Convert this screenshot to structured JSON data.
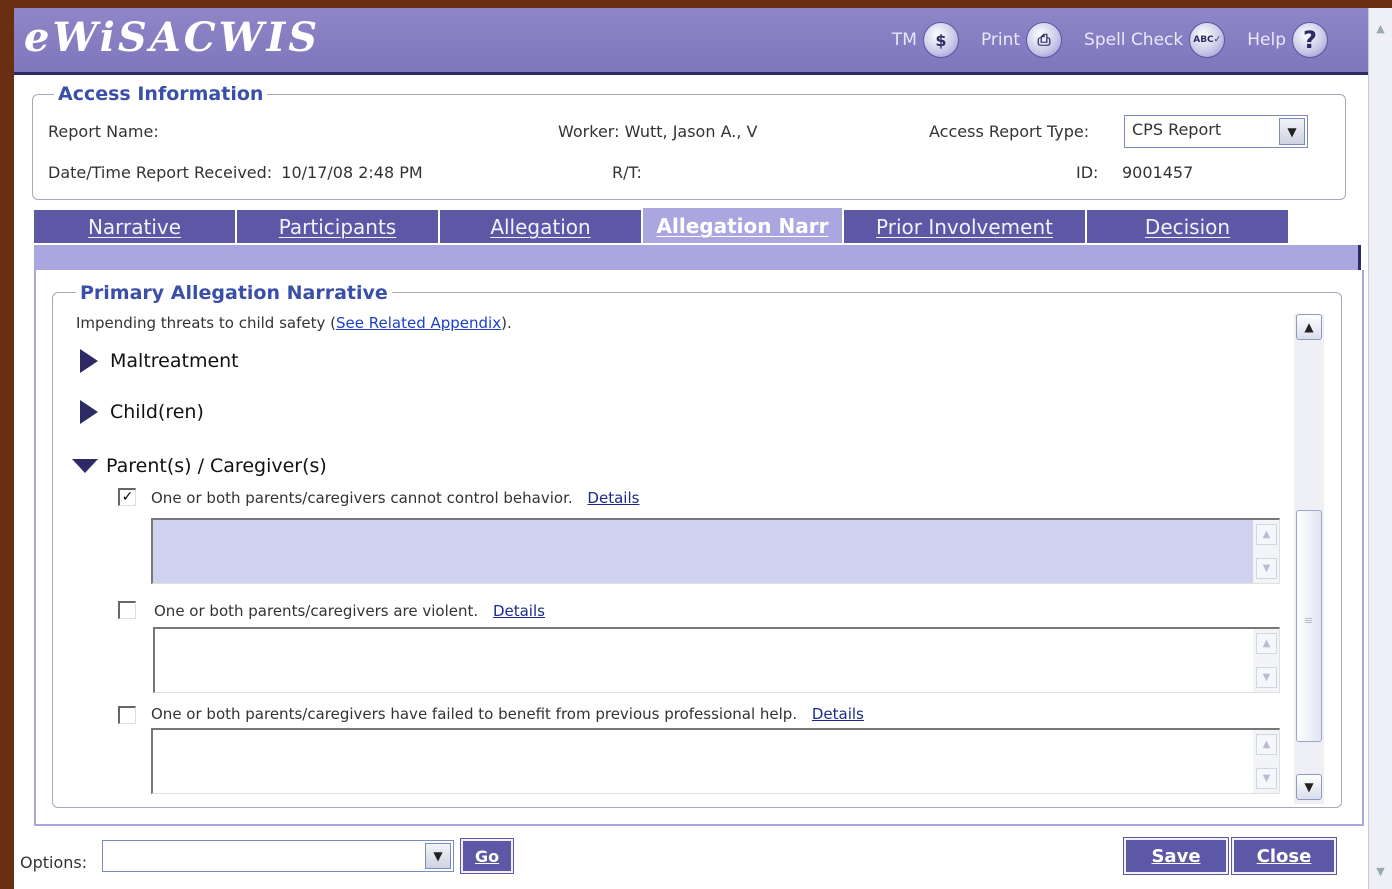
{
  "app": {
    "logo": "eWiSACWIS",
    "tools": [
      {
        "label": "TM",
        "icon": "tm-icon",
        "glyph": "$"
      },
      {
        "label": "Print",
        "icon": "printer-icon",
        "glyph": "⎙"
      },
      {
        "label": "Spell Check",
        "icon": "spell-check-icon",
        "glyph": "ABC✓"
      },
      {
        "label": "Help",
        "icon": "help-icon",
        "glyph": "?"
      }
    ]
  },
  "access_info": {
    "legend": "Access Information",
    "report_name_label": "Report Name:",
    "worker_label": "Worker:",
    "worker_value": "Wutt, Jason A., V",
    "report_type_label": "Access Report Type:",
    "report_type_value": "CPS Report",
    "received_label": "Date/Time Report Received:",
    "received_value": "10/17/08 2:48 PM",
    "rt_label": "R/T:",
    "id_label": "ID:",
    "id_value": "9001457"
  },
  "tabs": [
    {
      "label": "Narrative",
      "active": false
    },
    {
      "label": "Participants",
      "active": false
    },
    {
      "label": "Allegation",
      "active": false
    },
    {
      "label": "Allegation Narr",
      "active": true
    },
    {
      "label": "Prior Involvement",
      "active": false
    },
    {
      "label": "Decision",
      "active": false
    }
  ],
  "narrative": {
    "legend": "Primary Allegation Narrative",
    "intro_text": "Impending threats to child safety (",
    "intro_link": "See Related Appendix",
    "intro_end": ").",
    "sections": [
      {
        "label": "Maltreatment",
        "expanded": false
      },
      {
        "label": "Child(ren)",
        "expanded": false
      },
      {
        "label": "Parent(s) / Caregiver(s)",
        "expanded": true
      }
    ],
    "items": [
      {
        "text": "One or both parents/caregivers cannot control behavior.",
        "details": "Details",
        "checked": true,
        "value": ""
      },
      {
        "text": "One or both parents/caregivers are violent.",
        "details": "Details",
        "checked": false,
        "value": ""
      },
      {
        "text": "One or both parents/caregivers have failed to benefit from previous professional help.",
        "details": "Details",
        "checked": false,
        "value": ""
      }
    ]
  },
  "footer": {
    "options_label": "Options:",
    "options_value": "",
    "go_label": "Go",
    "save_label": "Save",
    "close_label": "Close"
  },
  "colors": {
    "header": "#8f86c8",
    "tab": "#5c58a6",
    "tab_active": "#aaa7e0",
    "legend_text": "#3a4fa8",
    "link": "#1c3fc4"
  }
}
